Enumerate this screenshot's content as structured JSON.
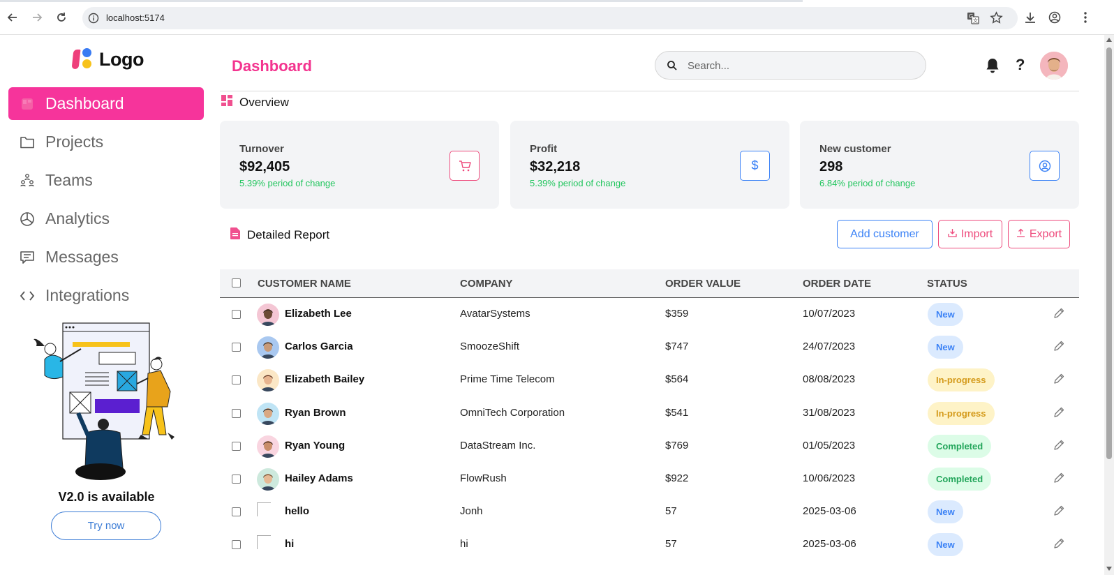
{
  "browser": {
    "url": "localhost:5174"
  },
  "sidebar": {
    "logo_text": "Logo",
    "items": [
      {
        "label": "Dashboard",
        "icon": "dashboard-icon",
        "active": true
      },
      {
        "label": "Projects",
        "icon": "folder-icon",
        "active": false
      },
      {
        "label": "Teams",
        "icon": "teams-icon",
        "active": false
      },
      {
        "label": "Analytics",
        "icon": "pie-chart-icon",
        "active": false
      },
      {
        "label": "Messages",
        "icon": "message-icon",
        "active": false
      },
      {
        "label": "Integrations",
        "icon": "code-icon",
        "active": false
      }
    ],
    "promo_title": "V2.0 is available",
    "promo_button": "Try now"
  },
  "header": {
    "title": "Dashboard",
    "search_placeholder": "Search...",
    "help_label": "?"
  },
  "overview": {
    "title": "Overview",
    "cards": [
      {
        "label": "Turnover",
        "value": "$92,405",
        "change": "5.39% period of change",
        "icon": "cart-icon",
        "accent": "#ee4a7c"
      },
      {
        "label": "Profit",
        "value": "$32,218",
        "change": "5.39% period of change",
        "icon": "dollar-icon",
        "accent": "#3b82f6"
      },
      {
        "label": "New customer",
        "value": "298",
        "change": "6.84% period of change",
        "icon": "user-circle-icon",
        "accent": "#3b82f6"
      }
    ]
  },
  "report": {
    "title": "Detailed Report",
    "add_label": "Add customer",
    "import_label": "Import",
    "export_label": "Export",
    "columns": [
      "CUSTOMER NAME",
      "COMPANY",
      "ORDER VALUE",
      "ORDER DATE",
      "STATUS"
    ],
    "rows": [
      {
        "name": "Elizabeth Lee",
        "company": "AvatarSystems",
        "value": "$359",
        "date": "10/07/2023",
        "status": "New",
        "status_type": "new",
        "avatar": "avatar-1"
      },
      {
        "name": "Carlos Garcia",
        "company": "SmoozeShift",
        "value": "$747",
        "date": "24/07/2023",
        "status": "New",
        "status_type": "new",
        "avatar": "avatar-2"
      },
      {
        "name": "Elizabeth Bailey",
        "company": "Prime Time Telecom",
        "value": "$564",
        "date": "08/08/2023",
        "status": "In-progress",
        "status_type": "progress",
        "avatar": "avatar-3"
      },
      {
        "name": "Ryan Brown",
        "company": "OmniTech Corporation",
        "value": "$541",
        "date": "31/08/2023",
        "status": "In-progress",
        "status_type": "progress",
        "avatar": "avatar-4"
      },
      {
        "name": "Ryan Young",
        "company": "DataStream Inc.",
        "value": "$769",
        "date": "01/05/2023",
        "status": "Completed",
        "status_type": "completed",
        "avatar": "avatar-5"
      },
      {
        "name": "Hailey Adams",
        "company": "FlowRush",
        "value": "$922",
        "date": "10/06/2023",
        "status": "Completed",
        "status_type": "completed",
        "avatar": "avatar-6"
      },
      {
        "name": "hello",
        "company": "Jonh",
        "value": "57",
        "date": "2025-03-06",
        "status": "New",
        "status_type": "new",
        "avatar": "broken-image"
      },
      {
        "name": "hi",
        "company": "hi",
        "value": "57",
        "date": "2025-03-06",
        "status": "New",
        "status_type": "new",
        "avatar": "broken-image"
      }
    ]
  },
  "colors": {
    "brand_pink": "#f6349b",
    "title_pink": "#f3348f",
    "blue": "#3b82f6",
    "green": "#22c55e"
  }
}
